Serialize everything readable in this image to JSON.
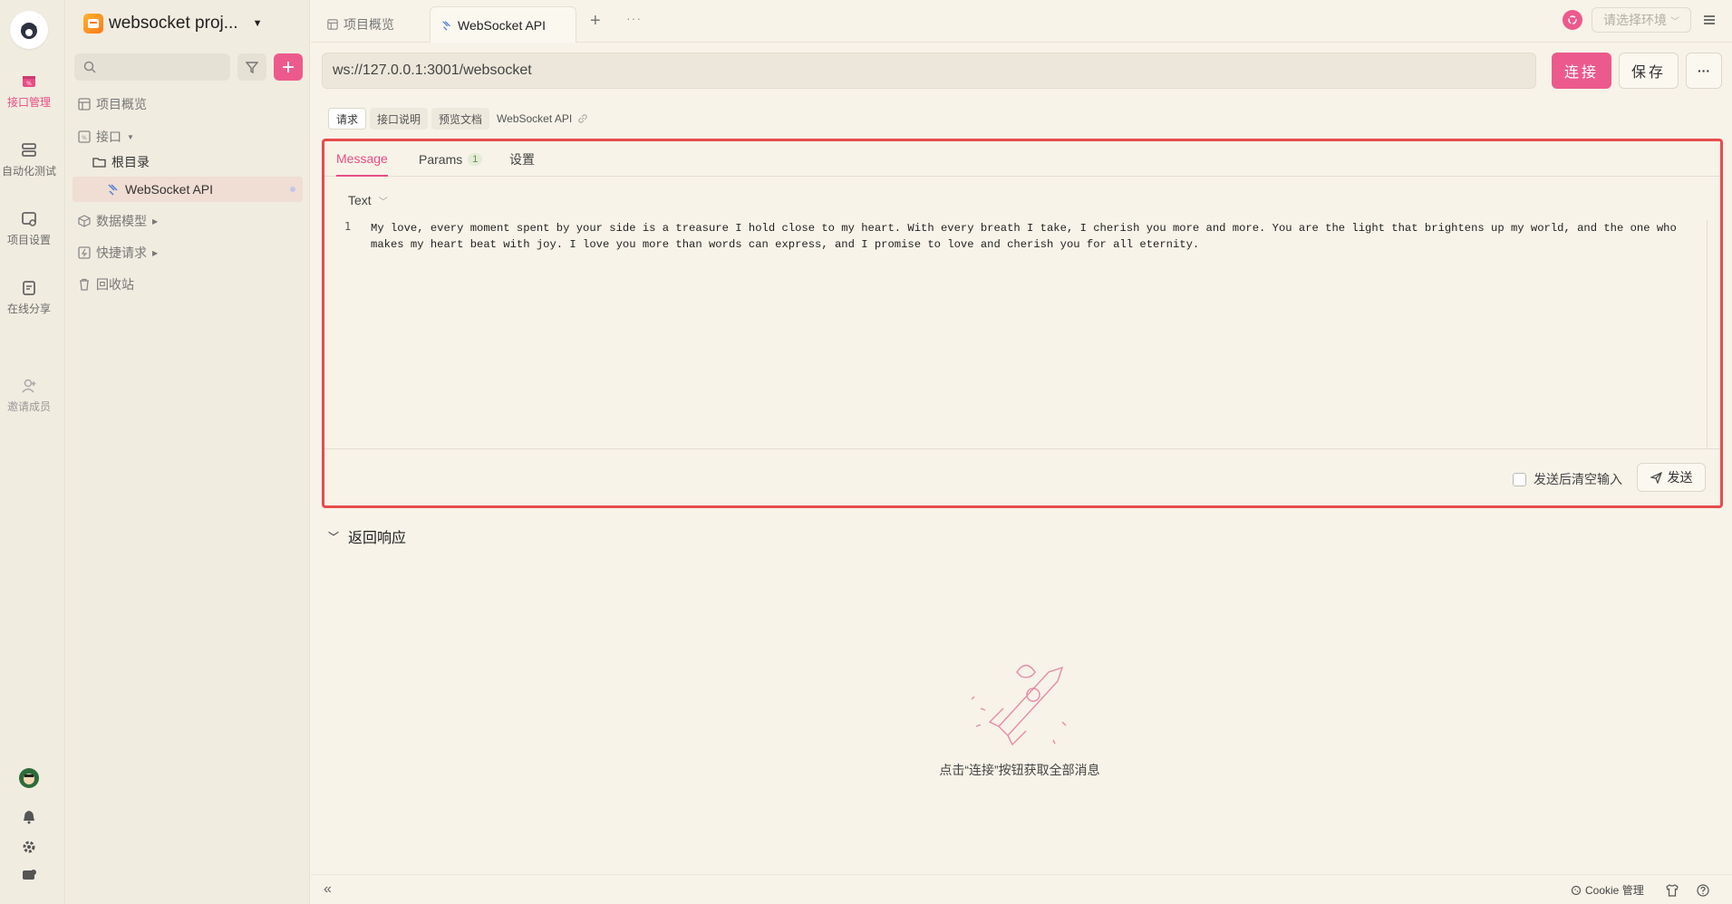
{
  "rail": {
    "items": [
      {
        "label": "接口管理",
        "icon": "api-manage-icon",
        "active": true
      },
      {
        "label": "自动化测试",
        "icon": "automation-icon"
      },
      {
        "label": "项目设置",
        "icon": "project-settings-icon"
      },
      {
        "label": "在线分享",
        "icon": "share-icon"
      },
      {
        "label": "邀请成员",
        "icon": "invite-member-icon"
      }
    ]
  },
  "sidebar": {
    "project_name": "websocket proj...",
    "tree": [
      {
        "label": "项目概览"
      },
      {
        "label": "接口"
      },
      {
        "label": "根目录"
      },
      {
        "label": "WebSocket API"
      },
      {
        "label": "数据模型"
      },
      {
        "label": "快捷请求"
      },
      {
        "label": "回收站"
      }
    ]
  },
  "tabs": [
    {
      "label": "项目概览"
    },
    {
      "label": "WebSocket API"
    }
  ],
  "env": {
    "placeholder": "请选择环境"
  },
  "request": {
    "url": "ws://127.0.0.1:3001/websocket",
    "connect_label": "连接",
    "save_label": "保存"
  },
  "subtabs": [
    "请求",
    "接口说明",
    "预览文档"
  ],
  "api_name": "WebSocket API",
  "panel": {
    "tabs": [
      {
        "label": "Message"
      },
      {
        "label": "Params",
        "count": "1"
      },
      {
        "label": "设置"
      }
    ],
    "body_type": "Text",
    "line_number": "1",
    "message": "My love, every moment spent by your side is a treasure I hold close to my heart. With every breath I take, I cherish you more and more. You are the light that brightens up my world, and the one who makes my heart beat with joy. I love you more than words can express, and I promise to love and cherish you for all eternity.",
    "clear_after_send": "发送后清空输入",
    "send_label": "发送"
  },
  "response": {
    "title": "返回响应",
    "empty_hint": "点击“连接”按钮获取全部消息"
  },
  "footer": {
    "cookie_label": "Cookie 管理"
  },
  "colors": {
    "accent": "#ec5a8d",
    "highlight_border": "#e74c4c",
    "background": "#f7f3e8"
  }
}
